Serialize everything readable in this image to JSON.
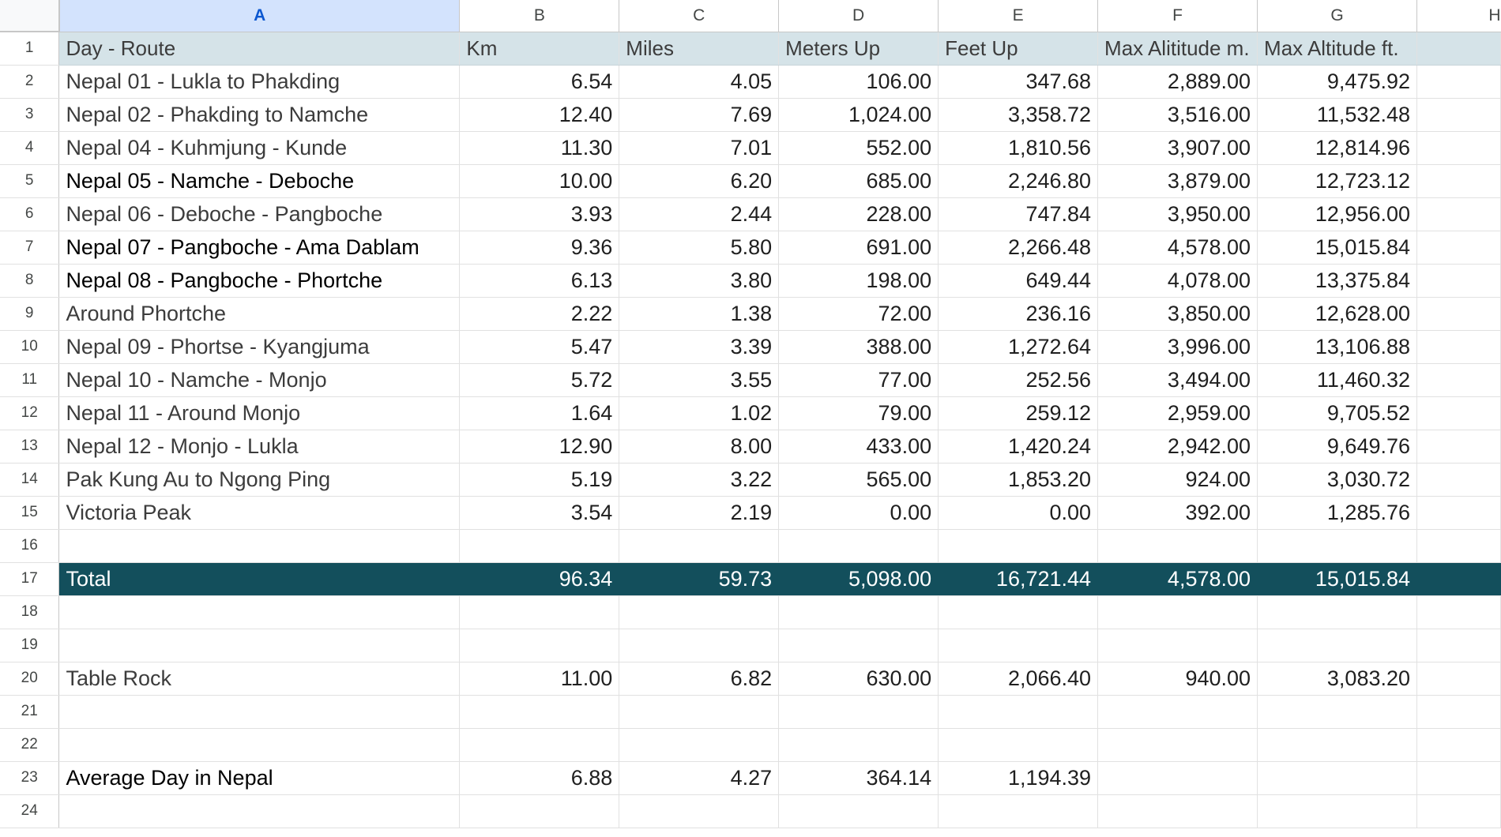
{
  "columns": [
    "A",
    "B",
    "C",
    "D",
    "E",
    "F",
    "G",
    "H"
  ],
  "header": [
    "Day - Route",
    "Km",
    "Miles",
    "Meters Up",
    "Feet Up",
    "Max Alititude m.",
    "Max Altitude ft."
  ],
  "rows": [
    {
      "n": "1"
    },
    {
      "n": "2",
      "cells": [
        "Nepal 01 - Lukla to Phakding",
        "6.54",
        "4.05",
        "106.00",
        "347.68",
        "2,889.00",
        "9,475.92"
      ]
    },
    {
      "n": "3",
      "cells": [
        "Nepal 02 - Phakding to Namche",
        "12.40",
        "7.69",
        "1,024.00",
        "3,358.72",
        "3,516.00",
        "11,532.48"
      ]
    },
    {
      "n": "4",
      "cells": [
        "Nepal 04 - Kuhmjung - Kunde",
        "11.30",
        "7.01",
        "552.00",
        "1,810.56",
        "3,907.00",
        "12,814.96"
      ]
    },
    {
      "n": "5",
      "cells": [
        "Nepal 05 - Namche - Deboche",
        "10.00",
        "6.20",
        "685.00",
        "2,246.80",
        "3,879.00",
        "12,723.12"
      ]
    },
    {
      "n": "6",
      "cells": [
        "Nepal 06 - Deboche - Pangboche",
        "3.93",
        "2.44",
        "228.00",
        "747.84",
        "3,950.00",
        "12,956.00"
      ]
    },
    {
      "n": "7",
      "cells": [
        "Nepal 07 - Pangboche - Ama Dablam",
        "9.36",
        "5.80",
        "691.00",
        "2,266.48",
        "4,578.00",
        "15,015.84"
      ]
    },
    {
      "n": "8",
      "cells": [
        "Nepal 08 - Pangboche - Phortche",
        "6.13",
        "3.80",
        "198.00",
        "649.44",
        "4,078.00",
        "13,375.84"
      ]
    },
    {
      "n": "9",
      "cells": [
        "Around Phortche",
        "2.22",
        "1.38",
        "72.00",
        "236.16",
        "3,850.00",
        "12,628.00"
      ]
    },
    {
      "n": "10",
      "cells": [
        "Nepal 09 - Phortse - Kyangjuma",
        "5.47",
        "3.39",
        "388.00",
        "1,272.64",
        "3,996.00",
        "13,106.88"
      ]
    },
    {
      "n": "11",
      "cells": [
        "Nepal 10 - Namche - Monjo",
        "5.72",
        "3.55",
        "77.00",
        "252.56",
        "3,494.00",
        "11,460.32"
      ]
    },
    {
      "n": "12",
      "cells": [
        "Nepal 11 - Around Monjo",
        "1.64",
        "1.02",
        "79.00",
        "259.12",
        "2,959.00",
        "9,705.52"
      ]
    },
    {
      "n": "13",
      "cells": [
        "Nepal 12 - Monjo - Lukla",
        "12.90",
        "8.00",
        "433.00",
        "1,420.24",
        "2,942.00",
        "9,649.76"
      ]
    },
    {
      "n": "14",
      "cells": [
        "Pak Kung Au to Ngong Ping",
        "5.19",
        "3.22",
        "565.00",
        "1,853.20",
        "924.00",
        "3,030.72"
      ]
    },
    {
      "n": "15",
      "cells": [
        "Victoria Peak",
        "3.54",
        "2.19",
        "0.00",
        "0.00",
        "392.00",
        "1,285.76"
      ]
    },
    {
      "n": "16",
      "cells": [
        "",
        "",
        "",
        "",
        "",
        "",
        ""
      ]
    },
    {
      "n": "17",
      "cells": [
        "Total",
        "96.34",
        "59.73",
        "5,098.00",
        "16,721.44",
        "4,578.00",
        "15,015.84"
      ]
    },
    {
      "n": "18",
      "cells": [
        "",
        "",
        "",
        "",
        "",
        "",
        ""
      ]
    },
    {
      "n": "19",
      "cells": [
        "",
        "",
        "",
        "",
        "",
        "",
        ""
      ]
    },
    {
      "n": "20",
      "cells": [
        "Table Rock",
        "11.00",
        "6.82",
        "630.00",
        "2,066.40",
        "940.00",
        "3,083.20"
      ]
    },
    {
      "n": "21",
      "cells": [
        "",
        "",
        "",
        "",
        "",
        "",
        ""
      ]
    },
    {
      "n": "22",
      "cells": [
        "",
        "",
        "",
        "",
        "",
        "",
        ""
      ]
    },
    {
      "n": "23",
      "cells": [
        "Average Day in Nepal",
        "6.88",
        "4.27",
        "364.14",
        "1,194.39",
        "",
        ""
      ]
    },
    {
      "n": "24",
      "cells": [
        "",
        "",
        "",
        "",
        "",
        "",
        ""
      ]
    }
  ],
  "colors": {
    "header_fill": "#d5e3e8",
    "total_fill": "#134f5c",
    "selected_column_fill": "#d3e3fd"
  }
}
